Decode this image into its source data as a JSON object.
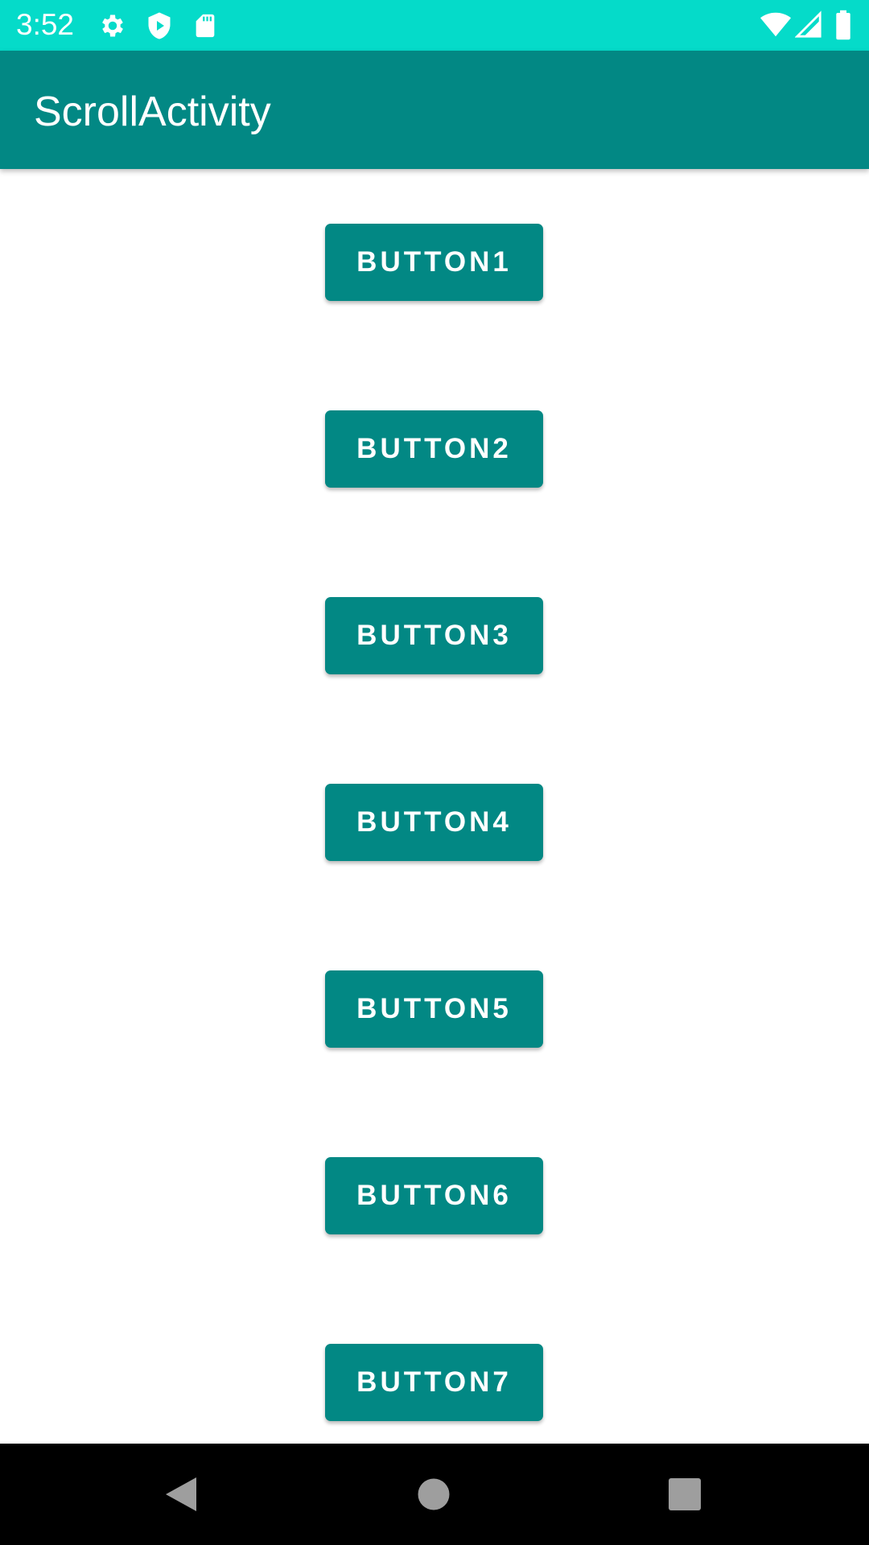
{
  "status_bar": {
    "time": "3:52",
    "background_color": "#05dbc9",
    "left_icons": [
      "gear-icon",
      "shield-play-icon",
      "sd-card-icon"
    ],
    "right_icons": [
      "wifi-icon",
      "cell-signal-icon",
      "battery-icon"
    ]
  },
  "app_bar": {
    "title": "ScrollActivity",
    "background_color": "#028884"
  },
  "buttons": [
    {
      "label": "BUTTON1"
    },
    {
      "label": "BUTTON2"
    },
    {
      "label": "BUTTON3"
    },
    {
      "label": "BUTTON4"
    },
    {
      "label": "BUTTON5"
    },
    {
      "label": "BUTTON6"
    },
    {
      "label": "BUTTON7"
    }
  ],
  "nav_bar": {
    "icons": [
      "back-icon",
      "home-icon",
      "recents-icon"
    ]
  }
}
